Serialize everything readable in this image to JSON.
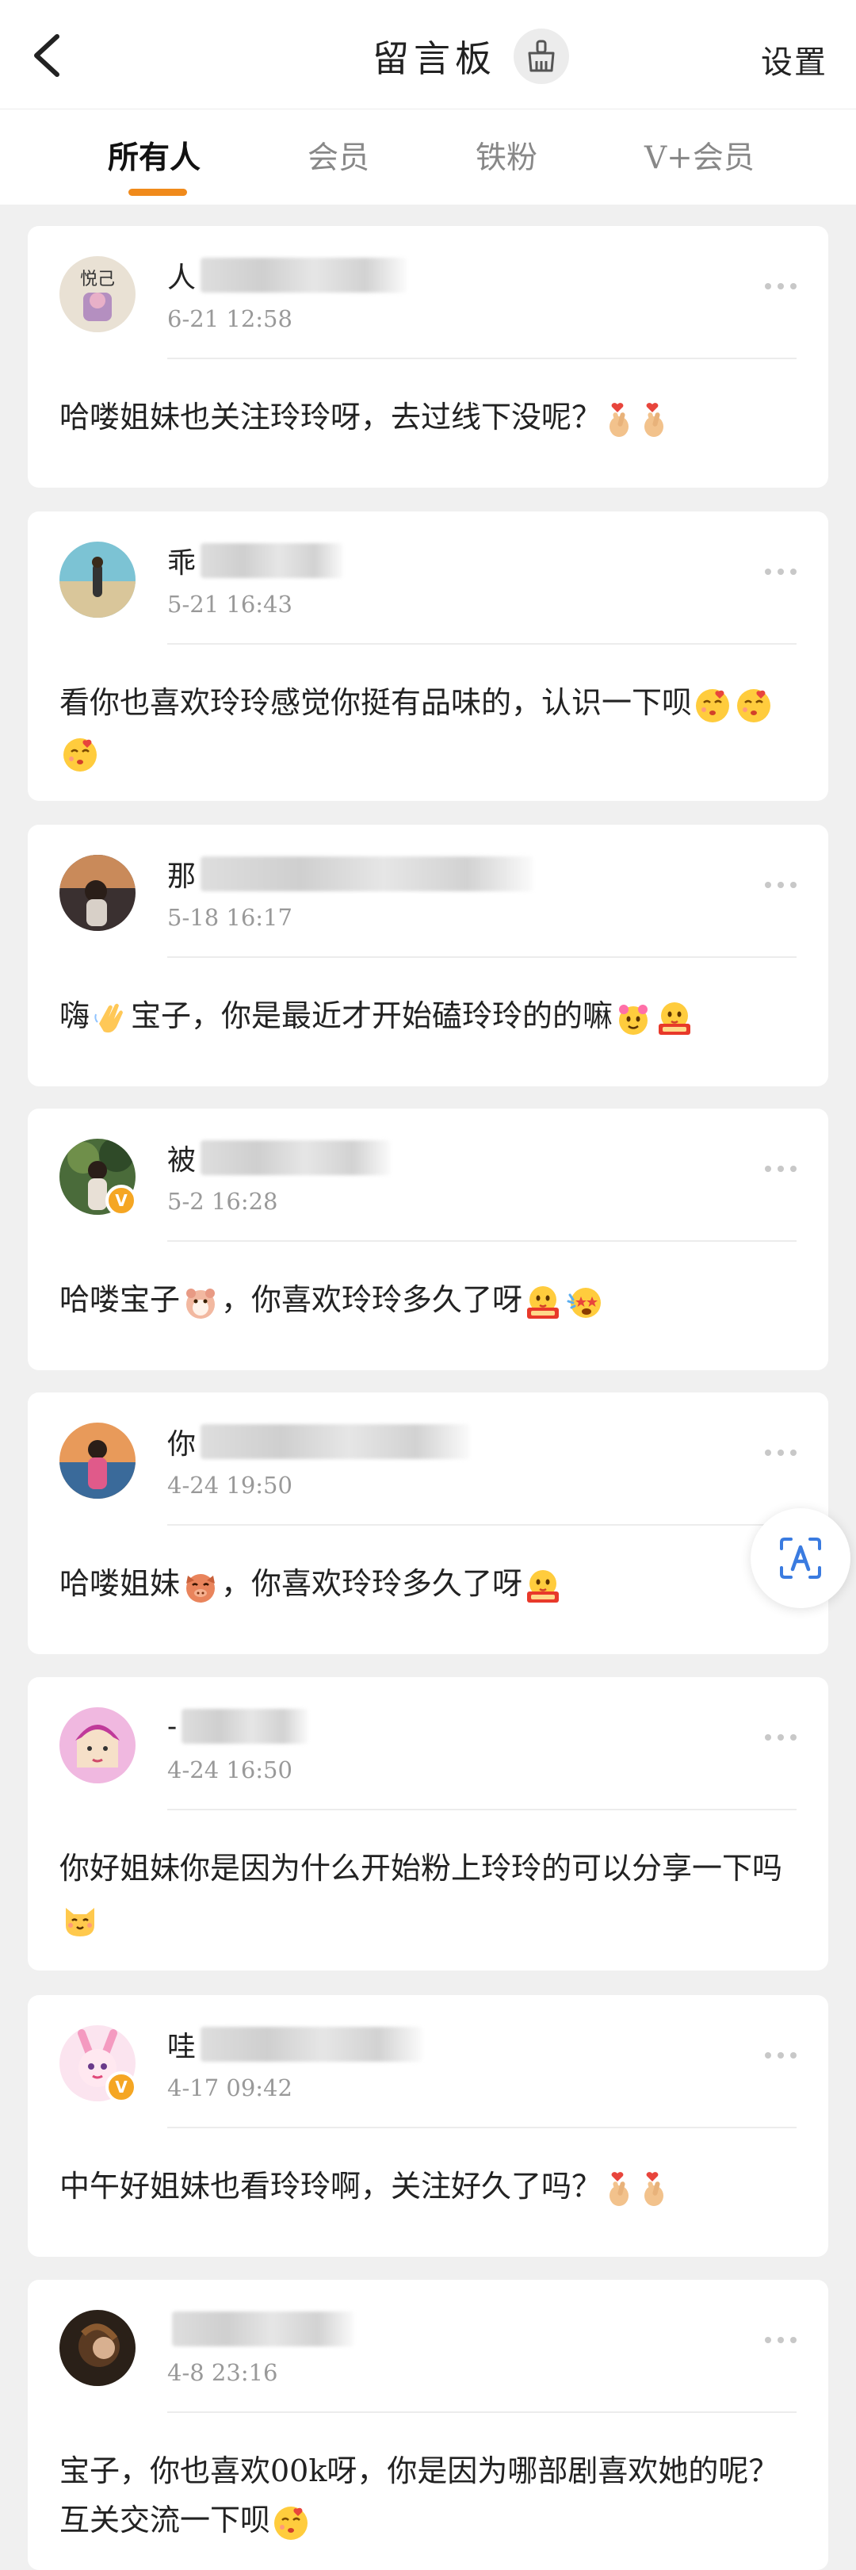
{
  "header": {
    "title": "留言板",
    "settings_label": "设置"
  },
  "tabs": [
    {
      "label": "所有人",
      "active": true
    },
    {
      "label": "会员",
      "active": false
    },
    {
      "label": "铁粉",
      "active": false
    },
    {
      "label": "V+会员",
      "active": false
    }
  ],
  "colors": {
    "accent": "#f08a1b",
    "vip_badge": "#f5a623"
  },
  "messages": [
    {
      "name_prefix": "人",
      "time": "6-21 12:58",
      "text_a": "哈喽姐妹也关注玲玲呀，去过线下没呢？",
      "text_b": "",
      "emojis": [
        "fingers-heart-icon",
        "fingers-heart-icon"
      ],
      "vip": false
    },
    {
      "name_prefix": "乖",
      "time": "5-21 16:43",
      "text_a": "看你也喜欢玲玲感觉你挺有品味的，认识一下呗",
      "text_b": "",
      "emojis": [
        "kiss-face-icon",
        "kiss-face-icon",
        "kiss-face-icon"
      ],
      "vip": false
    },
    {
      "name_prefix": "那",
      "time": "5-18 16:17",
      "text_a": "嗨",
      "text_b": "宝子，你是最近才开始磕玲玲的的嘛",
      "emojis": [
        "wave-hand-icon",
        "flower-face-icon",
        "kiss-badge-icon"
      ],
      "vip": false
    },
    {
      "name_prefix": "被",
      "time": "5-2 16:28",
      "text_a": "哈喽宝子",
      "text_b": "，你喜欢玲玲多久了呀",
      "emojis": [
        "hamster-icon",
        "kiss-badge-icon",
        "star-eyes-icon"
      ],
      "vip": true
    },
    {
      "name_prefix": "你",
      "time": "4-24 19:50",
      "text_a": "哈喽姐妹",
      "text_b": "，你喜欢玲玲多久了呀",
      "emojis": [
        "piggy-icon",
        "kiss-badge-icon"
      ],
      "vip": false
    },
    {
      "name_prefix": "-",
      "time": "4-24 16:50",
      "text_a": "你好姐妹你是因为什么开始粉上玲玲的可以分享一下吗",
      "text_b": "",
      "emojis": [
        "cat-face-icon"
      ],
      "vip": false
    },
    {
      "name_prefix": "哇",
      "time": "4-17 09:42",
      "text_a": "中午好姐妹也看玲玲啊，关注好久了吗？",
      "text_b": "",
      "emojis": [
        "fingers-heart-icon",
        "fingers-heart-icon"
      ],
      "vip": true
    },
    {
      "name_prefix": "",
      "time": "4-8 23:16",
      "text_a": "宝子，你也喜欢00k呀，你是因为哪部剧喜欢她的呢？互关交流一下呗",
      "text_b": "",
      "emojis": [
        "kiss-face-icon"
      ],
      "vip": false
    }
  ]
}
